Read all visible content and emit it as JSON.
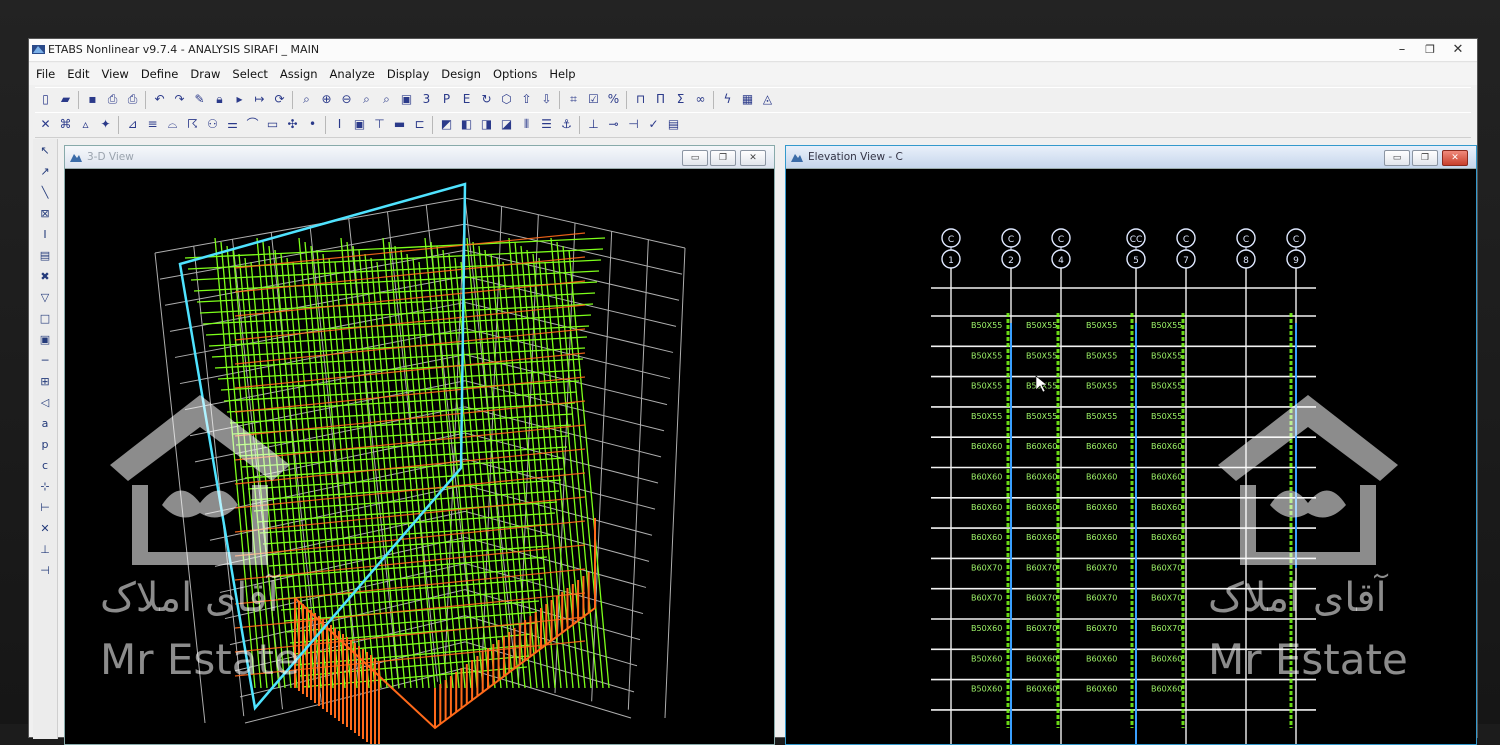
{
  "window": {
    "title": "ETABS Nonlinear v9.7.4 - ANALYSIS SIRAFI _ MAIN"
  },
  "menu": [
    {
      "label": "File"
    },
    {
      "label": "Edit"
    },
    {
      "label": "View"
    },
    {
      "label": "Define"
    },
    {
      "label": "Draw"
    },
    {
      "label": "Select"
    },
    {
      "label": "Assign"
    },
    {
      "label": "Analyze"
    },
    {
      "label": "Display"
    },
    {
      "label": "Design"
    },
    {
      "label": "Options"
    },
    {
      "label": "Help"
    }
  ],
  "panels": {
    "left": {
      "title": "3-D View"
    },
    "right": {
      "title": "Elevation View - C"
    }
  },
  "elevation": {
    "grid_bubbles_top": [
      "C",
      "C",
      "C",
      "CC",
      "C",
      "C",
      "C"
    ],
    "grid_bubbles_bottom": [
      "1",
      "2",
      "4",
      "5",
      "7",
      "8",
      "9"
    ],
    "beam_labels": [
      [
        "B50X55",
        "B50X55",
        "B50X55",
        "B50X55"
      ],
      [
        "B50X55",
        "B50X55",
        "B50X55",
        "B50X55"
      ],
      [
        "B50X55",
        "B50X55",
        "B50X55",
        "B50X55"
      ],
      [
        "B50X55",
        "B50X55",
        "B50X55",
        "B50X55"
      ],
      [
        "B60X60",
        "B60X60",
        "B60X60",
        "B60X60"
      ],
      [
        "B60X60",
        "B60X60",
        "B60X60",
        "B60X60"
      ],
      [
        "B60X60",
        "B60X60",
        "B60X60",
        "B60X60"
      ],
      [
        "B60X60",
        "B60X60",
        "B60X60",
        "B60X60"
      ],
      [
        "B60X70",
        "B60X70",
        "B60X70",
        "B60X70"
      ],
      [
        "B60X70",
        "B60X70",
        "B60X70",
        "B60X70"
      ],
      [
        "B50X60",
        "B60X70",
        "B60X70",
        "B60X70"
      ],
      [
        "B50X60",
        "B60X60",
        "B60X60",
        "B60X60"
      ],
      [
        "B50X60",
        "B60X60",
        "B60X60",
        "B60X60"
      ]
    ]
  },
  "watermark": {
    "persian": "آقای املاک",
    "english": "Mr Estate"
  },
  "colors": {
    "frame_green": "#7dff1a",
    "frame_orange": "#ff6a1a",
    "selection_cyan": "#4fe3ff",
    "grid_white": "#e8e8e8"
  }
}
